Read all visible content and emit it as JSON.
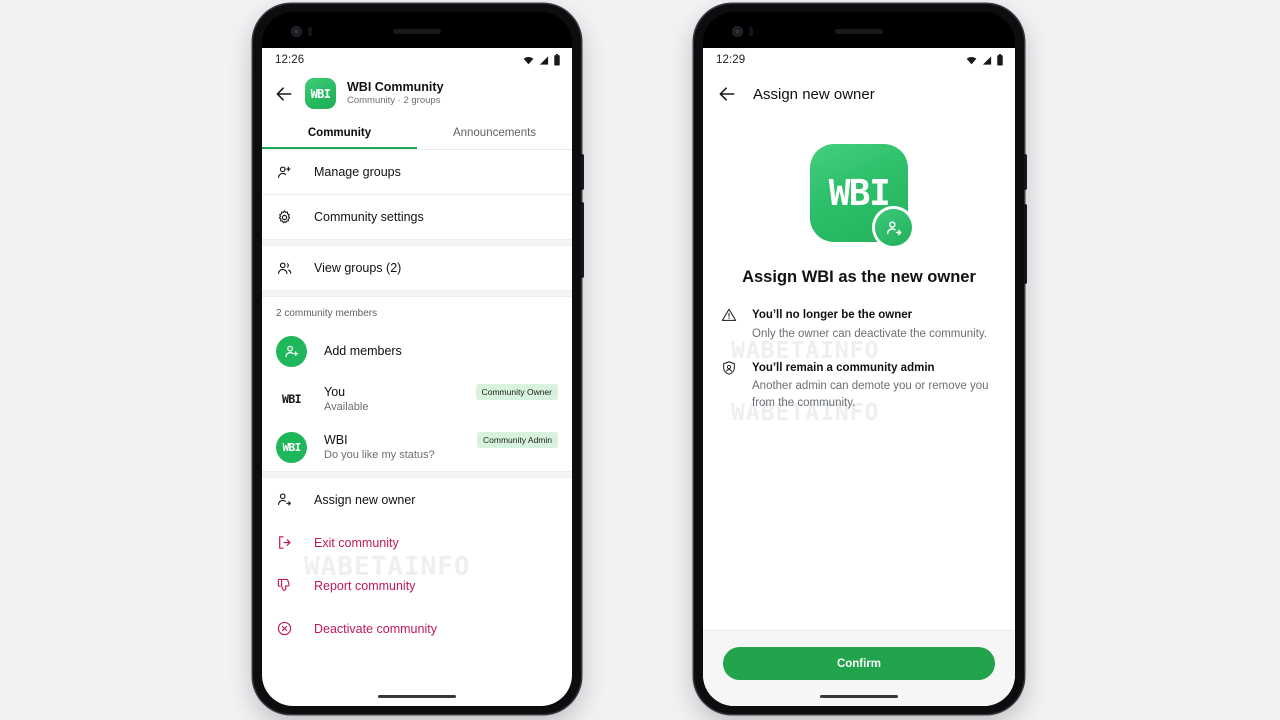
{
  "background_color": "#f1f2f4",
  "brand": {
    "accent_green": "#21a44c",
    "badge_bg": "#d9f2dd",
    "danger": "#c2185b",
    "logo_text": "WBI"
  },
  "watermark": {
    "text": "WABETAINFO"
  },
  "left_phone": {
    "status_bar": {
      "time": "12:26",
      "icons": [
        "wifi-icon",
        "signal-icon",
        "battery-icon"
      ]
    },
    "appbar": {
      "back_icon": "back-arrow-icon",
      "avatar_text": "WBI",
      "title": "WBI Community",
      "subtitle": "Community · 2 groups"
    },
    "tabs": [
      {
        "label": "Community",
        "active": true
      },
      {
        "label": "Announcements",
        "active": false
      }
    ],
    "actions_primary": [
      {
        "label": "Manage groups",
        "icon": "manage-groups-icon"
      },
      {
        "label": "Community settings",
        "icon": "gear-icon"
      }
    ],
    "actions_groups": [
      {
        "label": "View groups (2)",
        "icon": "view-groups-icon"
      }
    ],
    "members_section_label": "2 community members",
    "add_members": {
      "label": "Add members",
      "icon": "add-member-icon"
    },
    "members": [
      {
        "avatar_text": "WBI",
        "avatar_style": "plain",
        "name": "You",
        "status": "Available",
        "badge": "Community Owner"
      },
      {
        "avatar_text": "WBI",
        "avatar_style": "circle",
        "name": "WBI",
        "status": "Do you like my status?",
        "badge": "Community Admin"
      }
    ],
    "actions_bottom": [
      {
        "label": "Assign new owner",
        "icon": "assign-owner-icon",
        "danger": false
      },
      {
        "label": "Exit community",
        "icon": "exit-icon",
        "danger": true
      },
      {
        "label": "Report community",
        "icon": "thumbs-down-icon",
        "danger": true
      },
      {
        "label": "Deactivate community",
        "icon": "deactivate-icon",
        "danger": true
      }
    ]
  },
  "right_phone": {
    "status_bar": {
      "time": "12:29",
      "icons": [
        "wifi-icon",
        "signal-icon",
        "battery-icon"
      ]
    },
    "appbar": {
      "back_icon": "back-arrow-icon",
      "title": "Assign new owner"
    },
    "hero": {
      "logo_text": "WBI",
      "badge_icon": "assign-owner-icon",
      "title": "Assign WBI as the new owner"
    },
    "bullets": [
      {
        "icon": "warning-triangle-icon",
        "heading": "You’ll no longer be the owner",
        "body": "Only the owner can deactivate the community."
      },
      {
        "icon": "admin-shield-icon",
        "heading": "You’ll remain a community admin",
        "body": "Another admin can demote you or remove you from the community."
      }
    ],
    "footer": {
      "confirm_label": "Confirm"
    }
  }
}
